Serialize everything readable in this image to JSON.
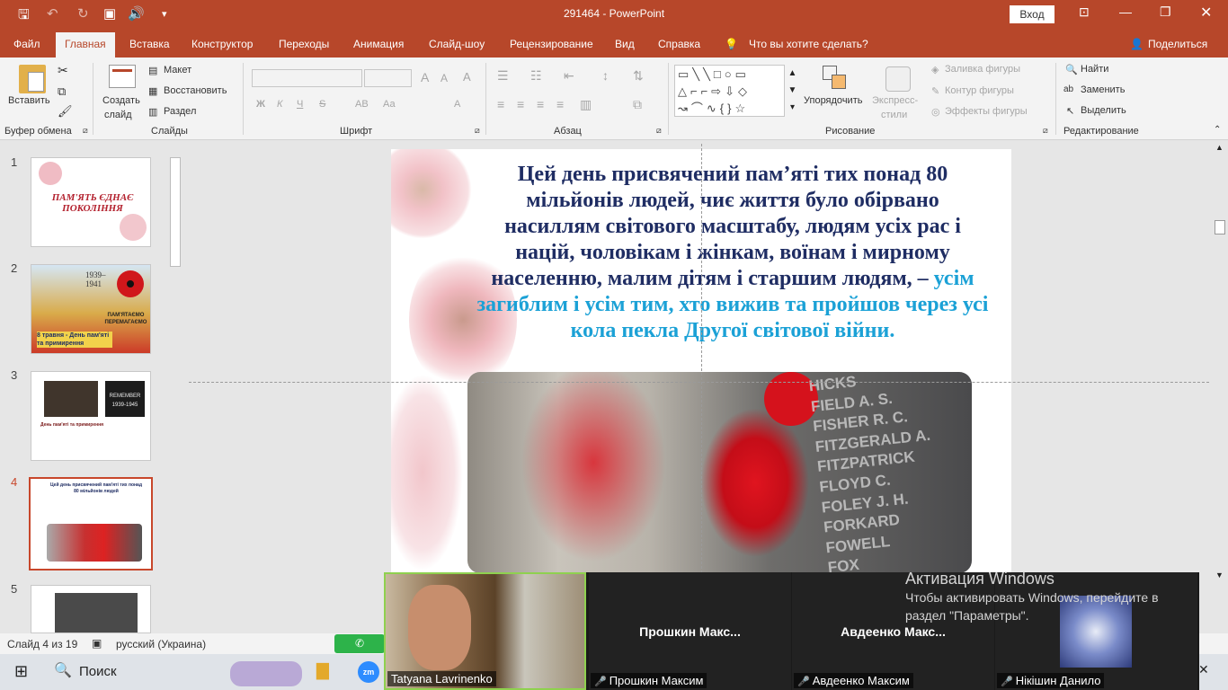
{
  "window": {
    "file_name": "291464",
    "app_name": "PowerPoint",
    "login_label": "Вход"
  },
  "tabs": [
    "Файл",
    "Главная",
    "Вставка",
    "Конструктор",
    "Переходы",
    "Анимация",
    "Слайд-шоу",
    "Рецензирование",
    "Вид",
    "Справка"
  ],
  "tell_me": "Что вы хотите сделать?",
  "share_label": "Поделиться",
  "ribbon": {
    "clipboard": {
      "paste": "Вставить",
      "group": "Буфер обмена"
    },
    "slides": {
      "new_slide_1": "Создать",
      "new_slide_2": "слайд",
      "layout": "Макет",
      "reset": "Восстановить",
      "section": "Раздел",
      "group": "Слайды"
    },
    "font": {
      "bold": "Ж",
      "italic": "К",
      "underline": "Ч",
      "strike": "S",
      "spacing": "АВ",
      "case": "Аа",
      "color": "А",
      "group": "Шрифт"
    },
    "paragraph": {
      "group": "Абзац"
    },
    "drawing": {
      "arrange": "Упорядочить",
      "styles_1": "Экспресс-",
      "styles_2": "стили",
      "fill": "Заливка фигуры",
      "outline": "Контур фигуры",
      "effects": "Эффекты фигуры",
      "group": "Рисование"
    },
    "editing": {
      "find": "Найти",
      "replace": "Заменить",
      "select": "Выделить",
      "group": "Редактирование"
    }
  },
  "thumbnails": [
    {
      "num": "1",
      "title": "ПАМ'ЯТЬ ЄДНАЄ ПОКОЛІННЯ"
    },
    {
      "num": "2",
      "years": "1939–1941",
      "remember": "ПАМ'ЯТАЄМО ПЕРЕМАГАЄМО",
      "caption": "8 травня - День пам'яті та примирення"
    },
    {
      "num": "3",
      "remember": "REMEMBER 1939-1945",
      "text": "День пам'яті та примирення"
    },
    {
      "num": "4",
      "text": "Цей день присвячений пам'яті тих понад 80 мільйонів людей"
    },
    {
      "num": "5"
    }
  ],
  "slide": {
    "text_main": "Цей день присвячений пам’яті тих понад 80 мільйонів людей, чиє життя було обірвано насиллям світового масштабу, людям усіх рас і націй, чоловікам і жінкам, воїнам і мирному населенню, малим дітям і старшим людям, –",
    "text_blue": "усім загиблим і усім тим, хто вижив та пройшов через усі кола пекла Другої світової війни.",
    "memorial_names": [
      "HICKS",
      "FIELD A. S.",
      "FISHER R. C.",
      "FITZGERALD A.",
      "FITZPATRICK",
      "FLOYD C.",
      "FOLEY J. H.",
      "FORKARD",
      "FOWELL",
      "FOX"
    ]
  },
  "status": {
    "slide_counter": "Слайд 4 из 19",
    "language": "русский (Украина)"
  },
  "taskbar": {
    "search": "Поиск"
  },
  "zoom": {
    "participants": [
      {
        "label": "Tatyana Lavrinenko"
      },
      {
        "name": "Прошкин  Макс...",
        "label": "Прошкин Максим"
      },
      {
        "name": "Авдеенко  Макс...",
        "label": "Авдеенко Максим"
      },
      {
        "label": "Нікішин Данило"
      }
    ]
  },
  "activation": {
    "title": "Активация Windows",
    "line1": "Чтобы активировать Windows, перейдите в",
    "line2": "раздел \"Параметры\"."
  }
}
